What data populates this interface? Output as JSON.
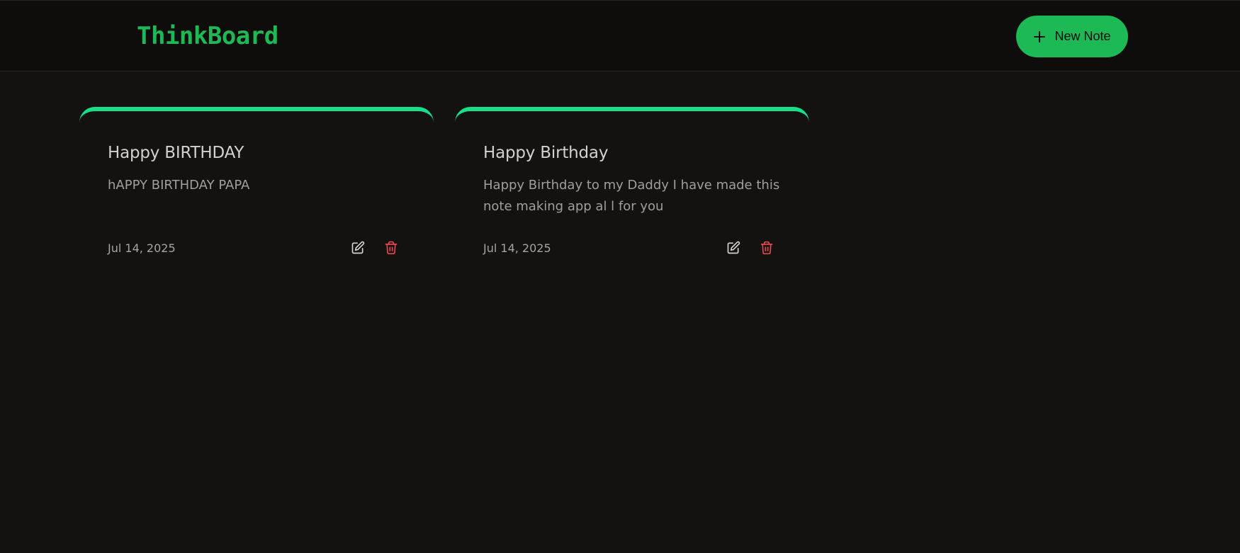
{
  "app": {
    "logo": "ThinkBoard",
    "new_note_label": "New Note"
  },
  "colors": {
    "accent": "#1db954",
    "card_top_border": "#16e08a",
    "delete": "#e5484d",
    "background": "#141111"
  },
  "notes": [
    {
      "title": "Happy BIRTHDAY",
      "content": "hAPPY BIRTHDAY PAPA",
      "date": "Jul 14, 2025",
      "edit_icon": "edit-icon",
      "delete_icon": "trash-icon"
    },
    {
      "title": "Happy Birthday",
      "content": "Happy Birthday to my Daddy I have made this note making app al l for you",
      "date": "Jul 14, 2025",
      "edit_icon": "edit-icon",
      "delete_icon": "trash-icon"
    }
  ]
}
